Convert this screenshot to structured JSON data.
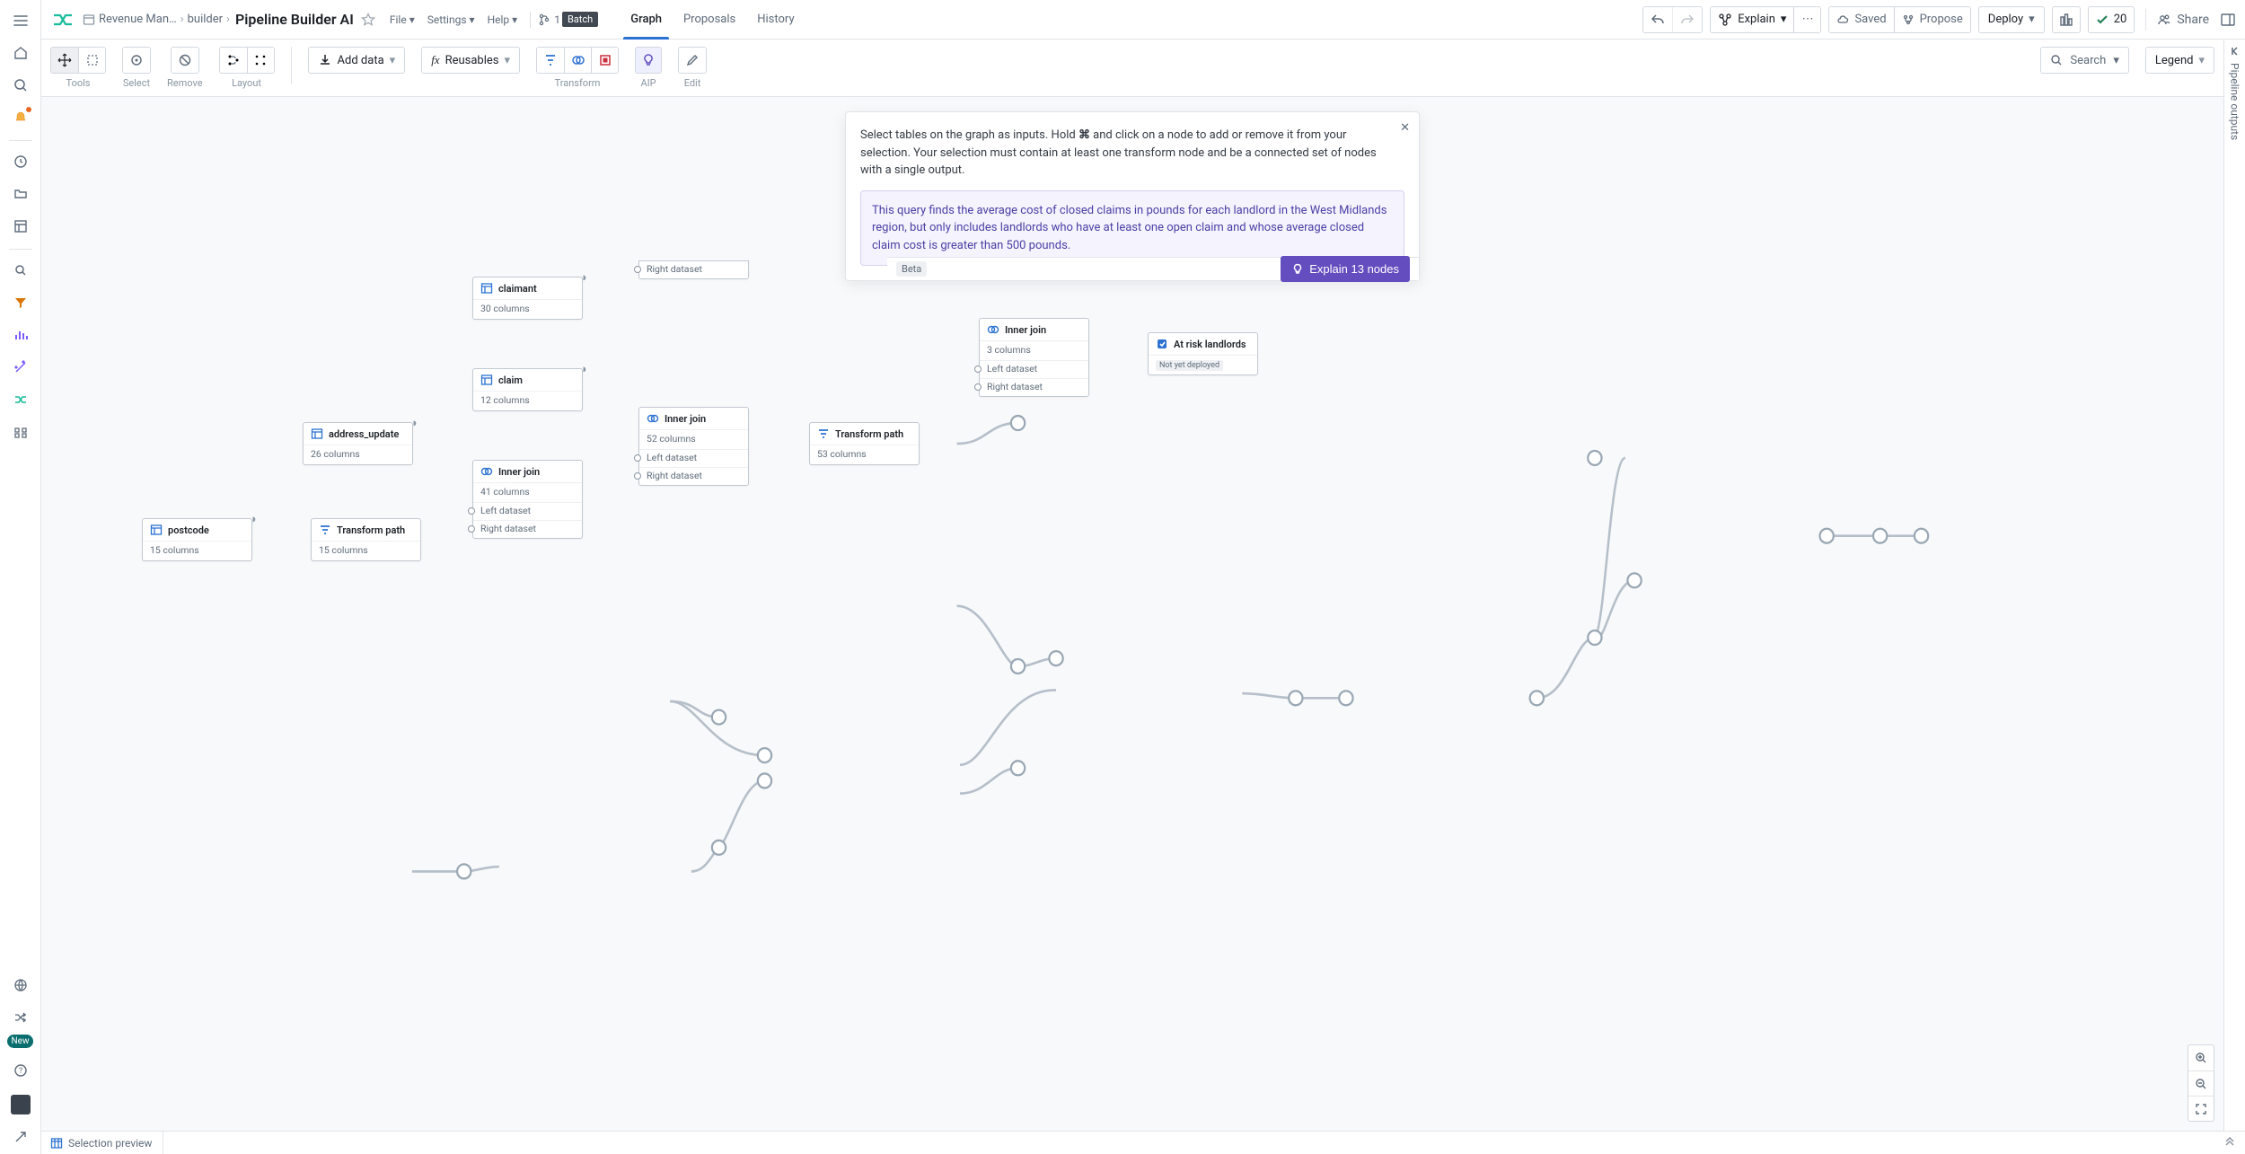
{
  "breadcrumb": {
    "project": "Revenue Man…",
    "folder": "builder"
  },
  "page_title": "Pipeline Builder AI",
  "menubar": {
    "file": "File",
    "settings": "Settings",
    "help": "Help",
    "count": "1",
    "batch": "Batch"
  },
  "tabs": {
    "graph": "Graph",
    "proposals": "Proposals",
    "history": "History"
  },
  "header": {
    "explain": "Explain",
    "saved": "Saved",
    "propose": "Propose",
    "deploy": "Deploy",
    "health_count": "20",
    "share": "Share"
  },
  "toolbar": {
    "tools": "Tools",
    "select": "Select",
    "remove": "Remove",
    "layout": "Layout",
    "add_data": "Add data",
    "reusables": "Reusables",
    "transform": "Transform",
    "aip": "AIP",
    "edit": "Edit",
    "search": "Search",
    "legend": "Legend"
  },
  "hint": {
    "instruction_a": "Select tables on the graph as inputs. Hold ",
    "cmd": "⌘",
    "instruction_b": " and click on a node to add or remove it from your selection. Your selection must contain at least one transform node and be a connected set of nodes with a single output.",
    "query": "This query finds the average cost of closed claims in pounds for each landlord in the West Midlands region, but only includes landlords who have at least one open claim and whose average closed claim cost is greater than 500 pounds.",
    "beta": "Beta",
    "explain_btn": "Explain 13 nodes"
  },
  "right_rail": "Pipeline outputs",
  "footer": {
    "selection_preview": "Selection preview"
  },
  "nodes": {
    "claimant": {
      "title": "claimant",
      "sub": "30 columns"
    },
    "claim": {
      "title": "claim",
      "sub": "12 columns"
    },
    "address_update": {
      "title": "address_update",
      "sub": "26 columns"
    },
    "postcode": {
      "title": "postcode",
      "sub": "15 columns"
    },
    "xform1": {
      "title": "Transform path",
      "sub": "15 columns"
    },
    "join1": {
      "title": "Inner join",
      "sub": "41 columns",
      "left": "Left dataset",
      "right": "Right dataset"
    },
    "join_top": {
      "right": "Right dataset"
    },
    "join2": {
      "title": "Inner join",
      "sub": "52 columns",
      "left": "Left dataset",
      "right": "Right dataset"
    },
    "xform2": {
      "title": "Transform path",
      "sub": "53 columns"
    },
    "join3": {
      "title": "Inner join",
      "sub": "3 columns",
      "left": "Left dataset",
      "right": "Right dataset"
    },
    "output": {
      "title": "At risk landlords",
      "badge": "Not yet deployed"
    }
  }
}
